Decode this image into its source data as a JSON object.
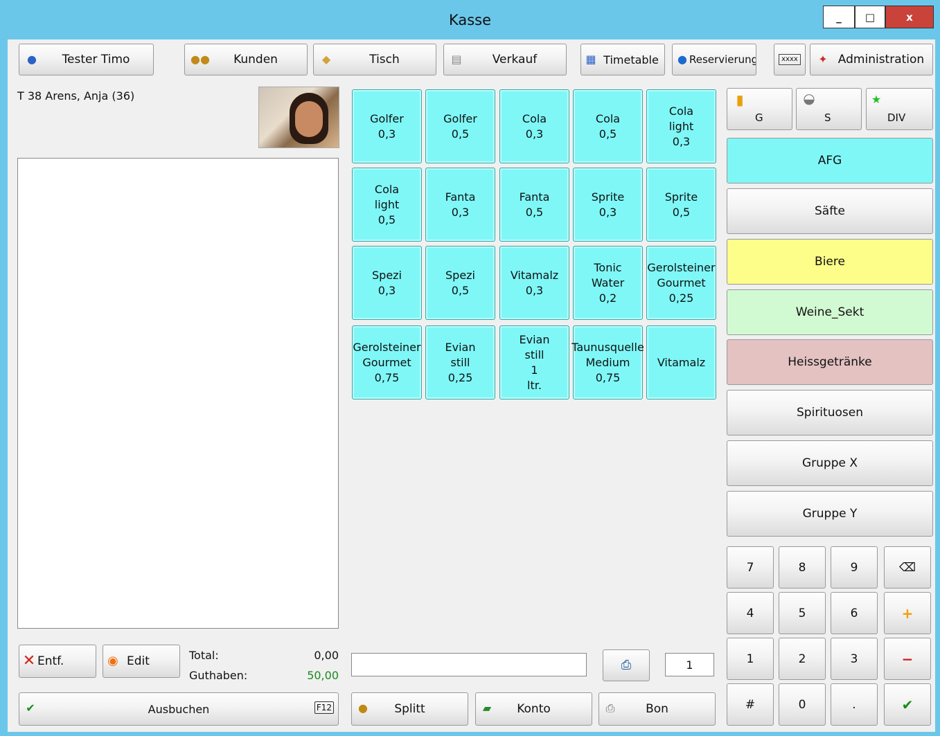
{
  "window": {
    "title": "Kasse",
    "controls": [
      "_",
      "□",
      "x"
    ]
  },
  "toolbar": [
    {
      "label": "Tester Timo",
      "icon": "user-icon"
    },
    {
      "label": "Kunden",
      "icon": "users-icon"
    },
    {
      "label": "Tisch",
      "icon": "table-icon"
    },
    {
      "label": "Verkauf",
      "icon": "sales-icon"
    },
    {
      "label": "Timetable",
      "icon": "timetable-icon"
    },
    {
      "label": "Reservierung",
      "icon": "globe-icon"
    },
    {
      "label": "",
      "icon": "keyboard-icon"
    },
    {
      "label": "Administration",
      "icon": "wand-icon"
    }
  ],
  "customer": {
    "line": "T 38 Arens, Anja (36)"
  },
  "products": [
    "Golfer\n0,3",
    "Golfer\n0,5",
    "Cola\n0,3",
    "Cola\n0,5",
    "Cola\nlight\n0,3",
    "Cola\nlight\n0,5",
    "Fanta\n0,3",
    "Fanta\n0,5",
    "Sprite\n0,3",
    "Sprite\n0,5",
    "Spezi\n0,3",
    "Spezi\n0,5",
    "Vitamalz\n0,3",
    "Tonic\nWater\n0,2",
    "Gerolsteiner\nGourmet\n0,25",
    "Gerolsteiner\nGourmet\n0,75",
    "Evian\nstill\n0,25",
    "Evian\nstill\n1\nltr.",
    "Taunusquelle\nMedium\n0,75",
    "Vitamalz"
  ],
  "quick_groups": [
    {
      "label": "G",
      "icon": "beer-icon"
    },
    {
      "label": "S",
      "icon": "pot-icon"
    },
    {
      "label": "DIV",
      "icon": "star-icon"
    }
  ],
  "categories": [
    {
      "label": "AFG",
      "color": "#7ff7f7"
    },
    {
      "label": "Säfte",
      "color": ""
    },
    {
      "label": "Biere",
      "color": "#fdfd8a"
    },
    {
      "label": "Weine_Sekt",
      "color": "#d2fad2"
    },
    {
      "label": "Heissgetränke",
      "color": "#e4c2c2"
    },
    {
      "label": "Spirituosen",
      "color": ""
    },
    {
      "label": "Gruppe X",
      "color": ""
    },
    {
      "label": "Gruppe Y",
      "color": ""
    }
  ],
  "numpad": [
    "7",
    "8",
    "9",
    "⌫",
    "4",
    "5",
    "6",
    "+",
    "1",
    "2",
    "3",
    "−",
    "#",
    "0",
    ".",
    "✔"
  ],
  "bottom": {
    "delete_label": "Entf.",
    "edit_label": "Edit",
    "total_label": "Total:",
    "total_value": "0,00",
    "credit_label": "Guthaben:",
    "credit_value": "50,00",
    "book_label": "Ausbuchen",
    "book_key": "F12",
    "split_label": "Splitt",
    "account_label": "Konto",
    "receipt_label": "Bon",
    "input_value": "",
    "quantity": "1"
  }
}
